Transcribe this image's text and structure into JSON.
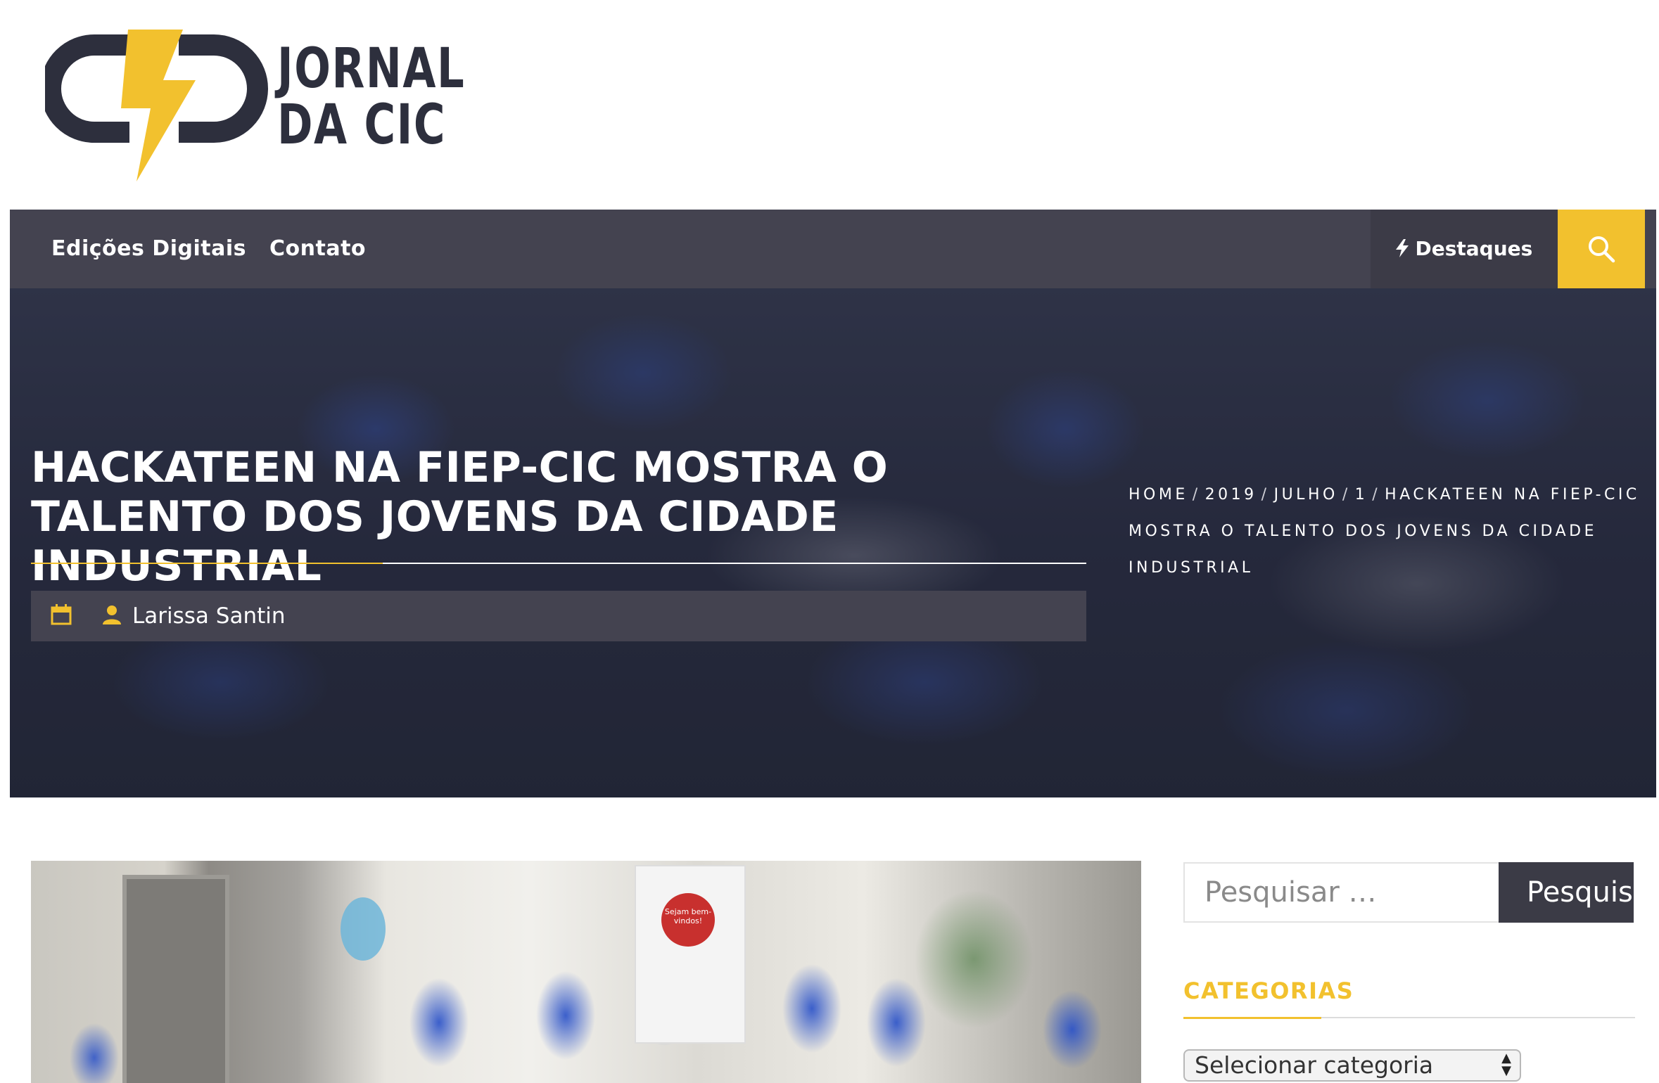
{
  "site": {
    "logo_line1": "JORNAL",
    "logo_line2": "DA CIC",
    "logo_icon": "lightning-cd-logo"
  },
  "nav": {
    "items": [
      {
        "label": "Edições Digitais"
      },
      {
        "label": "Contato"
      }
    ],
    "featured_label": "Destaques",
    "featured_icon": "bolt-icon",
    "search_icon": "search-icon"
  },
  "hero": {
    "title": "HACKATEEN NA FIEP-CIC MOSTRA O TALENTO DOS JOVENS DA CIDADE INDUSTRIAL",
    "date_icon": "calendar-icon",
    "author_icon": "user-icon",
    "author": "Larissa Santin",
    "breadcrumb": [
      "HOME",
      "2019",
      "JULHO",
      "1",
      "HACKATEEN NA FIEP-CIC MOSTRA O TALENTO DOS JOVENS DA CIDADE INDUSTRIAL"
    ]
  },
  "article_image": {
    "banner_text": "Sejam bem-vindos!"
  },
  "sidebar": {
    "search_placeholder": "Pesquisar …",
    "search_button": "Pesquisar",
    "categories_title": "CATEGORIAS",
    "categories_select": "Selecionar categoria"
  },
  "colors": {
    "accent": "#f2c12e",
    "nav_bg": "#444350",
    "logo_dark": "#2d2f3d"
  }
}
